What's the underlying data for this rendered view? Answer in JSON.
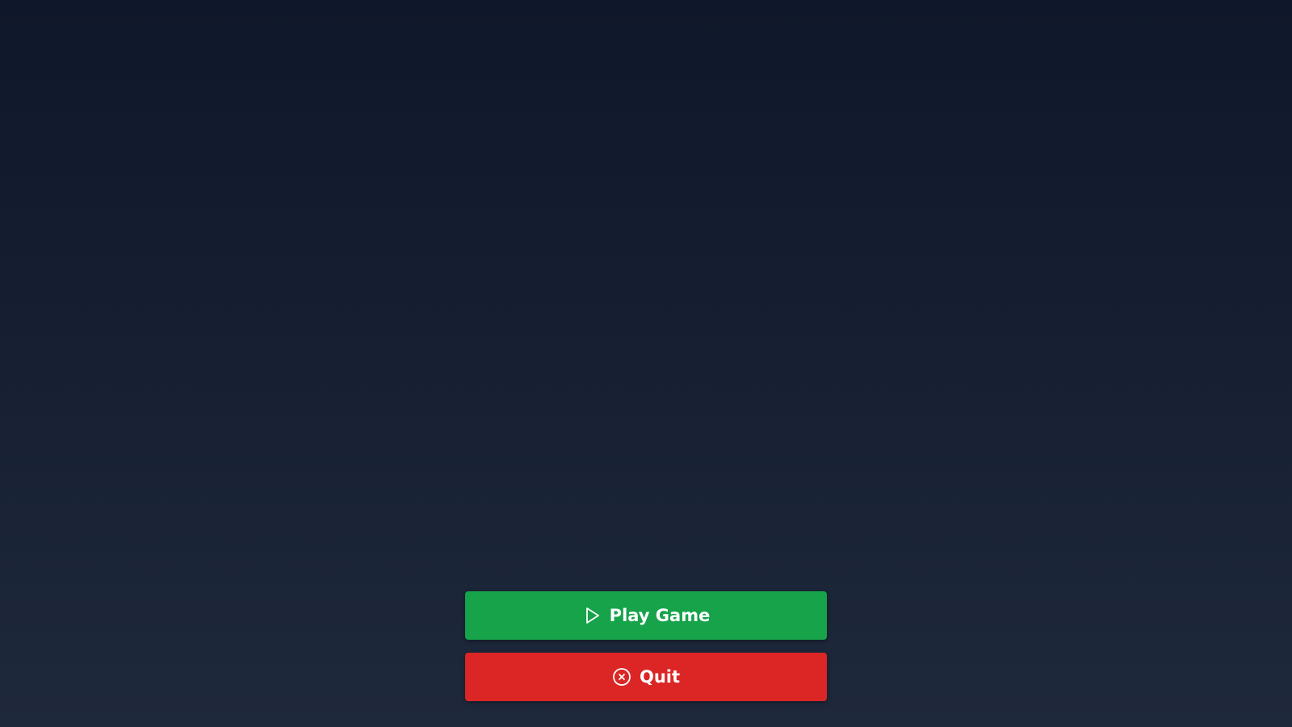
{
  "background": {
    "top_color": "#0f172a",
    "bottom_color": "#1e293b"
  },
  "menu": {
    "play": {
      "label": "Play Game",
      "icon": "play-icon",
      "color": "#16a34a"
    },
    "quit": {
      "label": "Quit",
      "icon": "close-circle-icon",
      "color": "#dc2626"
    }
  }
}
